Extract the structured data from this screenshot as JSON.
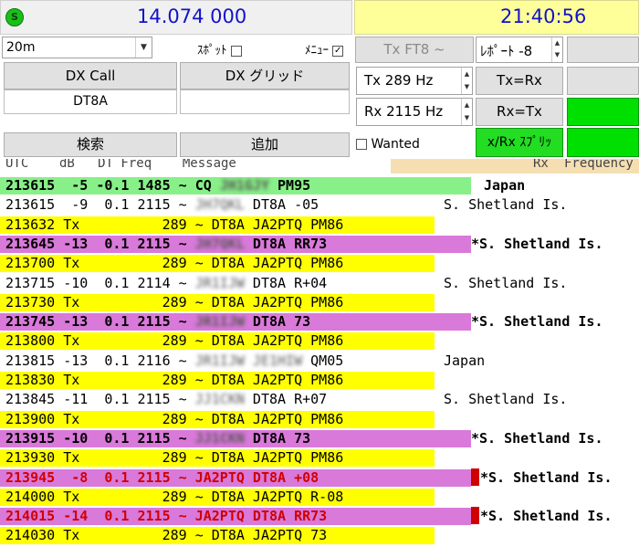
{
  "top": {
    "status_letter": "S",
    "dial_frequency": "14.074 000",
    "clock": "21:40:56"
  },
  "controls": {
    "band_value": "20m",
    "spot_label": "ｽﾎﾟｯﾄ",
    "menu_label": "ﾒﾆｭｰ",
    "menu_checked_mark": "✓",
    "mode_button": "Tx FT8 ~",
    "report_label": "ﾚﾎﾟｰﾄ -8",
    "dx_call_label": "DX Call",
    "dx_grid_label": "DX グリッド",
    "dx_call_value": "DT8A",
    "dx_grid_value": "",
    "tx_freq_label": "Tx  289  Hz",
    "rx_freq_label": "Rx  2115  Hz",
    "tx_eq_rx": "Tx=Rx",
    "rx_eq_tx": "Rx=Tx",
    "search_button": "検索",
    "add_button": "追加",
    "wanted_label": "Wanted",
    "split_button": "x/Rx ｽﾌﾟﾘｯ"
  },
  "list_header": {
    "columns_left": "UTC    dB   DT Freq    Message",
    "rx_label": "Rx",
    "frequency_label": "Frequency"
  },
  "colors": {
    "cq_green": "#88f088",
    "tx_yellow": "#ffff00",
    "to_me_magenta": "#d979d9",
    "clock_bg": "#ffff99",
    "split_green": "#22dd22",
    "red_text": "#d00000"
  },
  "rows": [
    {
      "type": "cq",
      "utc": "213615",
      "db": "-5",
      "dt": "-0.1",
      "freq": "1485",
      "pre": "~ CQ ",
      "blurred": "JH1GJY",
      "post": " PM95",
      "country": "Japan"
    },
    {
      "type": "normal",
      "utc": "213615",
      "db": "-9",
      "dt": "0.1",
      "freq": "2115",
      "pre": "~ ",
      "blurred": "JH7QKL",
      "post": " DT8A -05",
      "country": "S. Shetland Is."
    },
    {
      "type": "tx",
      "utc": "213632",
      "label": "Tx",
      "freq": "289",
      "post": "~ DT8A JA2PTQ PM86"
    },
    {
      "type": "me",
      "utc": "213645",
      "db": "-13",
      "dt": "0.1",
      "freq": "2115",
      "pre": "~ ",
      "blurred": "JH7QKL",
      "post": " DT8A RR73",
      "country": "*S. Shetland Is."
    },
    {
      "type": "tx",
      "utc": "213700",
      "label": "Tx",
      "freq": "289",
      "post": "~ DT8A JA2PTQ PM86"
    },
    {
      "type": "normal",
      "utc": "213715",
      "db": "-10",
      "dt": "0.1",
      "freq": "2114",
      "pre": "~ ",
      "blurred": "JR1IJW",
      "post": " DT8A R+04",
      "country": "S. Shetland Is."
    },
    {
      "type": "tx",
      "utc": "213730",
      "label": "Tx",
      "freq": "289",
      "post": "~ DT8A JA2PTQ PM86"
    },
    {
      "type": "me",
      "utc": "213745",
      "db": "-13",
      "dt": "0.1",
      "freq": "2115",
      "pre": "~ ",
      "blurred": "JR1IJW",
      "post": " DT8A 73",
      "country": "*S. Shetland Is."
    },
    {
      "type": "tx",
      "utc": "213800",
      "label": "Tx",
      "freq": "289",
      "post": "~ DT8A JA2PTQ PM86"
    },
    {
      "type": "normal",
      "utc": "213815",
      "db": "-13",
      "dt": "0.1",
      "freq": "2116",
      "pre": "~ ",
      "blurred": "JR1IJW JE1HIW",
      "post": " QM05",
      "country": "Japan"
    },
    {
      "type": "tx",
      "utc": "213830",
      "label": "Tx",
      "freq": "289",
      "post": "~ DT8A JA2PTQ PM86"
    },
    {
      "type": "normal",
      "utc": "213845",
      "db": "-11",
      "dt": "0.1",
      "freq": "2115",
      "pre": "~ ",
      "blurred": "JJ1CKN",
      "post": " DT8A R+07",
      "country": "S. Shetland Is."
    },
    {
      "type": "tx",
      "utc": "213900",
      "label": "Tx",
      "freq": "289",
      "post": "~ DT8A JA2PTQ PM86"
    },
    {
      "type": "me",
      "utc": "213915",
      "db": "-10",
      "dt": "0.1",
      "freq": "2115",
      "pre": "~ ",
      "blurred": "JJ1CKN",
      "post": " DT8A 73",
      "country": "*S. Shetland Is."
    },
    {
      "type": "tx",
      "utc": "213930",
      "label": "Tx",
      "freq": "289",
      "post": "~ DT8A JA2PTQ PM86"
    },
    {
      "type": "red",
      "utc": "213945",
      "db": "-8",
      "dt": "0.1",
      "freq": "2115",
      "pre": "~ JA2PTQ DT8A +08",
      "country": "*S. Shetland Is."
    },
    {
      "type": "tx",
      "utc": "214000",
      "label": "Tx",
      "freq": "289",
      "post": "~ DT8A JA2PTQ R-08"
    },
    {
      "type": "red",
      "utc": "214015",
      "db": "-14",
      "dt": "0.1",
      "freq": "2115",
      "pre": "~ JA2PTQ DT8A RR73",
      "country": "*S. Shetland Is."
    },
    {
      "type": "tx",
      "utc": "214030",
      "label": "Tx",
      "freq": "289",
      "post": "~ DT8A JA2PTQ 73"
    }
  ]
}
